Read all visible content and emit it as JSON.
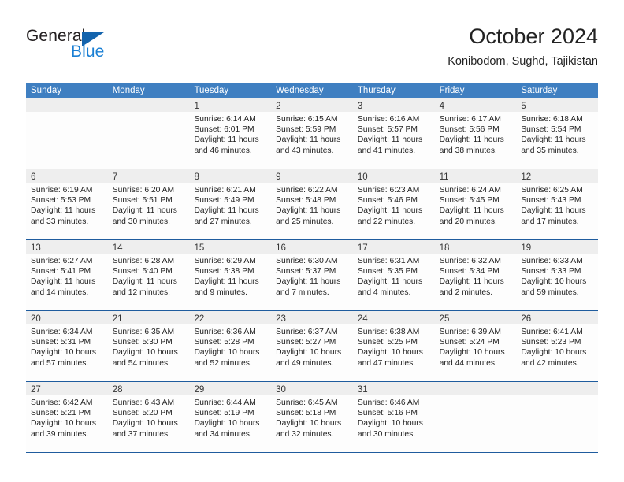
{
  "brand": {
    "name_part1": "General",
    "name_part2": "Blue",
    "triangle_color": "#1464ad",
    "blue_color": "#1a7fd4"
  },
  "header": {
    "title": "October 2024",
    "subtitle": "Konibodom, Sughd, Tajikistan"
  },
  "theme": {
    "header_row_bg": "#3f7fc1",
    "header_row_text": "#ffffff",
    "week_divider": "#1f5c9e",
    "date_strip_bg": "#eeeeee",
    "cell_bg": "#fdfdfd"
  },
  "weekdays": [
    "Sunday",
    "Monday",
    "Tuesday",
    "Wednesday",
    "Thursday",
    "Friday",
    "Saturday"
  ],
  "weeks": [
    [
      {
        "day": "",
        "sunrise": "",
        "sunset": "",
        "daylight_line1": "",
        "daylight_line2": ""
      },
      {
        "day": "",
        "sunrise": "",
        "sunset": "",
        "daylight_line1": "",
        "daylight_line2": ""
      },
      {
        "day": "1",
        "sunrise": "Sunrise: 6:14 AM",
        "sunset": "Sunset: 6:01 PM",
        "daylight_line1": "Daylight: 11 hours",
        "daylight_line2": "and 46 minutes."
      },
      {
        "day": "2",
        "sunrise": "Sunrise: 6:15 AM",
        "sunset": "Sunset: 5:59 PM",
        "daylight_line1": "Daylight: 11 hours",
        "daylight_line2": "and 43 minutes."
      },
      {
        "day": "3",
        "sunrise": "Sunrise: 6:16 AM",
        "sunset": "Sunset: 5:57 PM",
        "daylight_line1": "Daylight: 11 hours",
        "daylight_line2": "and 41 minutes."
      },
      {
        "day": "4",
        "sunrise": "Sunrise: 6:17 AM",
        "sunset": "Sunset: 5:56 PM",
        "daylight_line1": "Daylight: 11 hours",
        "daylight_line2": "and 38 minutes."
      },
      {
        "day": "5",
        "sunrise": "Sunrise: 6:18 AM",
        "sunset": "Sunset: 5:54 PM",
        "daylight_line1": "Daylight: 11 hours",
        "daylight_line2": "and 35 minutes."
      }
    ],
    [
      {
        "day": "6",
        "sunrise": "Sunrise: 6:19 AM",
        "sunset": "Sunset: 5:53 PM",
        "daylight_line1": "Daylight: 11 hours",
        "daylight_line2": "and 33 minutes."
      },
      {
        "day": "7",
        "sunrise": "Sunrise: 6:20 AM",
        "sunset": "Sunset: 5:51 PM",
        "daylight_line1": "Daylight: 11 hours",
        "daylight_line2": "and 30 minutes."
      },
      {
        "day": "8",
        "sunrise": "Sunrise: 6:21 AM",
        "sunset": "Sunset: 5:49 PM",
        "daylight_line1": "Daylight: 11 hours",
        "daylight_line2": "and 27 minutes."
      },
      {
        "day": "9",
        "sunrise": "Sunrise: 6:22 AM",
        "sunset": "Sunset: 5:48 PM",
        "daylight_line1": "Daylight: 11 hours",
        "daylight_line2": "and 25 minutes."
      },
      {
        "day": "10",
        "sunrise": "Sunrise: 6:23 AM",
        "sunset": "Sunset: 5:46 PM",
        "daylight_line1": "Daylight: 11 hours",
        "daylight_line2": "and 22 minutes."
      },
      {
        "day": "11",
        "sunrise": "Sunrise: 6:24 AM",
        "sunset": "Sunset: 5:45 PM",
        "daylight_line1": "Daylight: 11 hours",
        "daylight_line2": "and 20 minutes."
      },
      {
        "day": "12",
        "sunrise": "Sunrise: 6:25 AM",
        "sunset": "Sunset: 5:43 PM",
        "daylight_line1": "Daylight: 11 hours",
        "daylight_line2": "and 17 minutes."
      }
    ],
    [
      {
        "day": "13",
        "sunrise": "Sunrise: 6:27 AM",
        "sunset": "Sunset: 5:41 PM",
        "daylight_line1": "Daylight: 11 hours",
        "daylight_line2": "and 14 minutes."
      },
      {
        "day": "14",
        "sunrise": "Sunrise: 6:28 AM",
        "sunset": "Sunset: 5:40 PM",
        "daylight_line1": "Daylight: 11 hours",
        "daylight_line2": "and 12 minutes."
      },
      {
        "day": "15",
        "sunrise": "Sunrise: 6:29 AM",
        "sunset": "Sunset: 5:38 PM",
        "daylight_line1": "Daylight: 11 hours",
        "daylight_line2": "and 9 minutes."
      },
      {
        "day": "16",
        "sunrise": "Sunrise: 6:30 AM",
        "sunset": "Sunset: 5:37 PM",
        "daylight_line1": "Daylight: 11 hours",
        "daylight_line2": "and 7 minutes."
      },
      {
        "day": "17",
        "sunrise": "Sunrise: 6:31 AM",
        "sunset": "Sunset: 5:35 PM",
        "daylight_line1": "Daylight: 11 hours",
        "daylight_line2": "and 4 minutes."
      },
      {
        "day": "18",
        "sunrise": "Sunrise: 6:32 AM",
        "sunset": "Sunset: 5:34 PM",
        "daylight_line1": "Daylight: 11 hours",
        "daylight_line2": "and 2 minutes."
      },
      {
        "day": "19",
        "sunrise": "Sunrise: 6:33 AM",
        "sunset": "Sunset: 5:33 PM",
        "daylight_line1": "Daylight: 10 hours",
        "daylight_line2": "and 59 minutes."
      }
    ],
    [
      {
        "day": "20",
        "sunrise": "Sunrise: 6:34 AM",
        "sunset": "Sunset: 5:31 PM",
        "daylight_line1": "Daylight: 10 hours",
        "daylight_line2": "and 57 minutes."
      },
      {
        "day": "21",
        "sunrise": "Sunrise: 6:35 AM",
        "sunset": "Sunset: 5:30 PM",
        "daylight_line1": "Daylight: 10 hours",
        "daylight_line2": "and 54 minutes."
      },
      {
        "day": "22",
        "sunrise": "Sunrise: 6:36 AM",
        "sunset": "Sunset: 5:28 PM",
        "daylight_line1": "Daylight: 10 hours",
        "daylight_line2": "and 52 minutes."
      },
      {
        "day": "23",
        "sunrise": "Sunrise: 6:37 AM",
        "sunset": "Sunset: 5:27 PM",
        "daylight_line1": "Daylight: 10 hours",
        "daylight_line2": "and 49 minutes."
      },
      {
        "day": "24",
        "sunrise": "Sunrise: 6:38 AM",
        "sunset": "Sunset: 5:25 PM",
        "daylight_line1": "Daylight: 10 hours",
        "daylight_line2": "and 47 minutes."
      },
      {
        "day": "25",
        "sunrise": "Sunrise: 6:39 AM",
        "sunset": "Sunset: 5:24 PM",
        "daylight_line1": "Daylight: 10 hours",
        "daylight_line2": "and 44 minutes."
      },
      {
        "day": "26",
        "sunrise": "Sunrise: 6:41 AM",
        "sunset": "Sunset: 5:23 PM",
        "daylight_line1": "Daylight: 10 hours",
        "daylight_line2": "and 42 minutes."
      }
    ],
    [
      {
        "day": "27",
        "sunrise": "Sunrise: 6:42 AM",
        "sunset": "Sunset: 5:21 PM",
        "daylight_line1": "Daylight: 10 hours",
        "daylight_line2": "and 39 minutes."
      },
      {
        "day": "28",
        "sunrise": "Sunrise: 6:43 AM",
        "sunset": "Sunset: 5:20 PM",
        "daylight_line1": "Daylight: 10 hours",
        "daylight_line2": "and 37 minutes."
      },
      {
        "day": "29",
        "sunrise": "Sunrise: 6:44 AM",
        "sunset": "Sunset: 5:19 PM",
        "daylight_line1": "Daylight: 10 hours",
        "daylight_line2": "and 34 minutes."
      },
      {
        "day": "30",
        "sunrise": "Sunrise: 6:45 AM",
        "sunset": "Sunset: 5:18 PM",
        "daylight_line1": "Daylight: 10 hours",
        "daylight_line2": "and 32 minutes."
      },
      {
        "day": "31",
        "sunrise": "Sunrise: 6:46 AM",
        "sunset": "Sunset: 5:16 PM",
        "daylight_line1": "Daylight: 10 hours",
        "daylight_line2": "and 30 minutes."
      },
      {
        "day": "",
        "sunrise": "",
        "sunset": "",
        "daylight_line1": "",
        "daylight_line2": ""
      },
      {
        "day": "",
        "sunrise": "",
        "sunset": "",
        "daylight_line1": "",
        "daylight_line2": ""
      }
    ]
  ]
}
